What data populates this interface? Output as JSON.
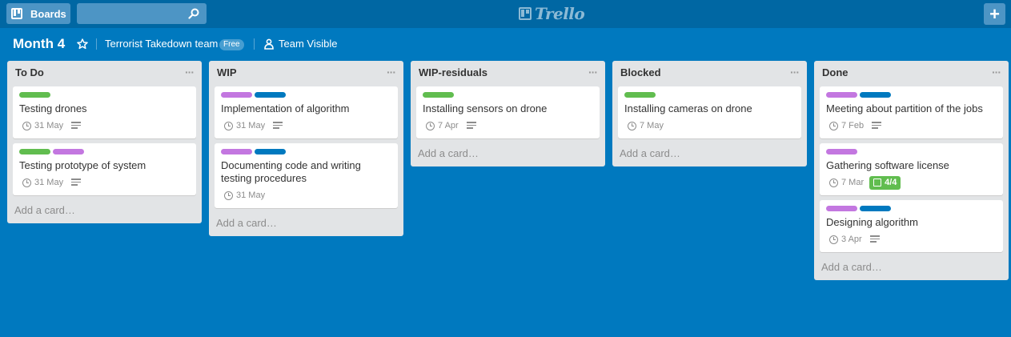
{
  "topbar": {
    "boards_label": "Boards",
    "search_value": "",
    "logo_text": "Trello",
    "add_label": "+"
  },
  "board": {
    "title": "Month 4",
    "team": "Terrorist Takedown team",
    "team_badge": "Free",
    "visibility": "Team Visible"
  },
  "colors": {
    "background": "#0079bf",
    "topbar": "#0067a3",
    "label_green": "#61bd4f",
    "label_purple": "#c377e0",
    "label_blue": "#0079bf"
  },
  "add_card_label": "Add a card…",
  "list_menu_glyph": "···",
  "lists": [
    {
      "name": "To Do",
      "cards": [
        {
          "title": "Testing drones",
          "labels": [
            "green"
          ],
          "due": "31 May",
          "description": true
        },
        {
          "title": "Testing prototype of system",
          "labels": [
            "green",
            "purple"
          ],
          "due": "31 May",
          "description": true
        }
      ]
    },
    {
      "name": "WIP",
      "cards": [
        {
          "title": "Implementation of algorithm",
          "labels": [
            "purple",
            "blue"
          ],
          "due": "31 May",
          "description": true
        },
        {
          "title": "Documenting code and writing testing procedures",
          "labels": [
            "purple",
            "blue"
          ],
          "due": "31 May",
          "description": false
        }
      ]
    },
    {
      "name": "WIP-residuals",
      "cards": [
        {
          "title": "Installing sensors on drone",
          "labels": [
            "green"
          ],
          "due": "7 Apr",
          "description": true
        }
      ]
    },
    {
      "name": "Blocked",
      "cards": [
        {
          "title": "Installing cameras on drone",
          "labels": [
            "green"
          ],
          "due": "7 May",
          "description": false
        }
      ]
    },
    {
      "name": "Done",
      "cards": [
        {
          "title": "Meeting about partition of the jobs",
          "labels": [
            "purple",
            "blue"
          ],
          "due": "7 Feb",
          "description": true
        },
        {
          "title": "Gathering software license",
          "labels": [
            "purple"
          ],
          "due": "7 Mar",
          "description": false,
          "checklist": "4/4"
        },
        {
          "title": "Designing algorithm",
          "labels": [
            "purple",
            "blue"
          ],
          "due": "3 Apr",
          "description": true
        }
      ]
    }
  ]
}
